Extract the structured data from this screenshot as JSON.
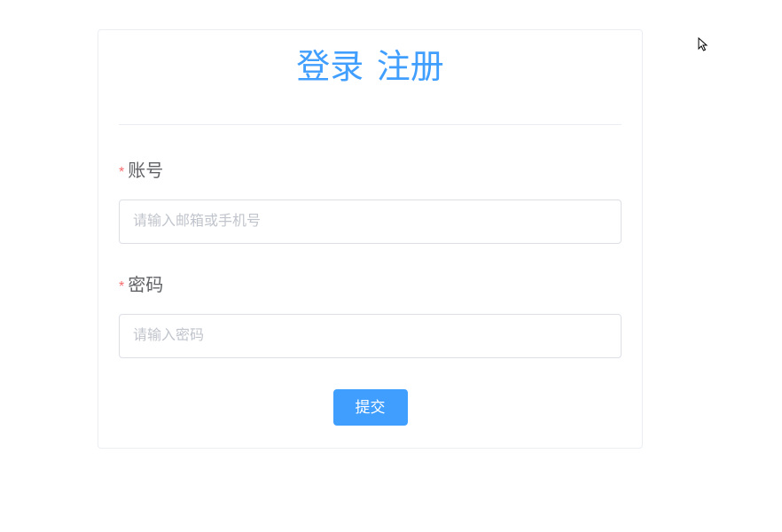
{
  "header": {
    "login_link": "登录",
    "register_link": "注册"
  },
  "form": {
    "account": {
      "label": "账号",
      "placeholder": "请输入邮箱或手机号",
      "value": ""
    },
    "password": {
      "label": "密码",
      "placeholder": "请输入密码",
      "value": ""
    },
    "submit_label": "提交"
  }
}
